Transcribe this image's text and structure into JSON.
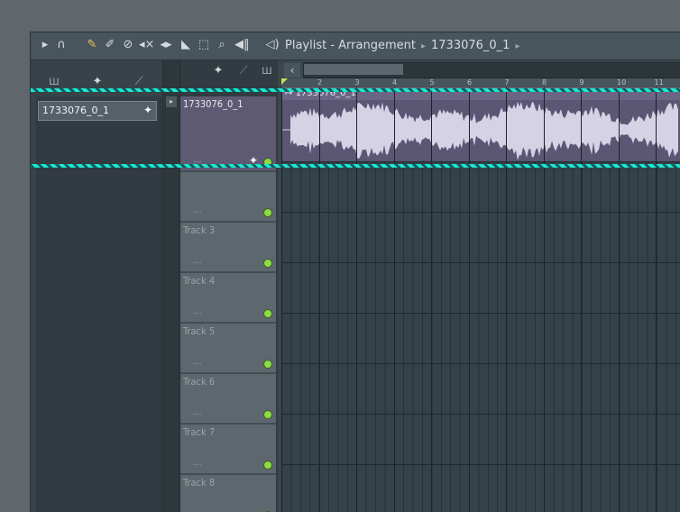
{
  "toolbar": {
    "title": "Playlist - Arrangement",
    "pattern_name": "1733076_0_1",
    "icons": [
      "arrow-right-icon",
      "magnet-icon",
      "pencil-icon",
      "paint-icon",
      "delete-icon",
      "mute-icon",
      "slip-icon",
      "slice-icon",
      "select-icon",
      "zoom-icon",
      "playback-icon",
      "speaker-icon"
    ]
  },
  "pattern_list": {
    "items": [
      {
        "label": "1733076_0_1",
        "icon": "audio-wave-icon"
      }
    ]
  },
  "tracks": [
    {
      "name": "1733076_0_1",
      "active": true
    },
    {
      "name": "",
      "active": false
    },
    {
      "name": "Track 3",
      "active": false
    },
    {
      "name": "Track 4",
      "active": false
    },
    {
      "name": "Track 5",
      "active": false
    },
    {
      "name": "Track 6",
      "active": false
    },
    {
      "name": "Track 7",
      "active": false
    },
    {
      "name": "Track 8",
      "active": false
    }
  ],
  "track_menu_glyph": "...",
  "clip": {
    "label": "1733076_0_1",
    "color": "#5b5673"
  },
  "ruler_ticks": [
    "2",
    "3",
    "4",
    "5",
    "6",
    "7",
    "8",
    "9",
    "10",
    "11"
  ],
  "colors": {
    "accent_highlight": "#1ee6d2",
    "led": "#8cdc45"
  }
}
